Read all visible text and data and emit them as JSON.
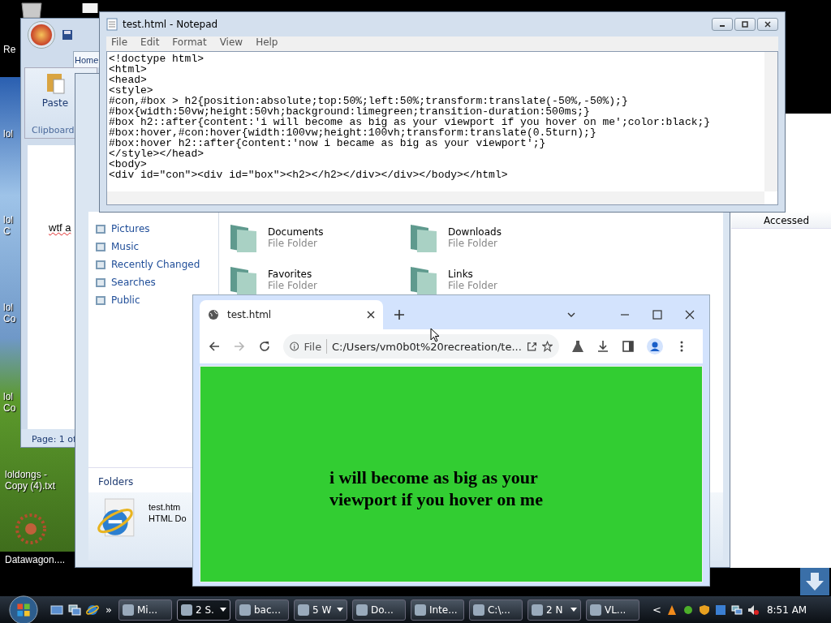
{
  "desktop": {
    "icons": [
      {
        "label": "Re"
      },
      {
        "label": "lol"
      },
      {
        "label": "lol C"
      },
      {
        "label": "lol Co"
      },
      {
        "label": "lol Co"
      },
      {
        "label": "loldongs - Copy (4).txt"
      },
      {
        "label": "Datawagon...."
      }
    ]
  },
  "wordpad": {
    "tabs": [
      {
        "label": "Home",
        "selected": true
      }
    ],
    "paste": "Paste",
    "group": "Clipboard",
    "text": "wtf a",
    "status": "Page: 1 of"
  },
  "explorer": {
    "nav_items": [
      {
        "label": "Pictures"
      },
      {
        "label": "Music"
      },
      {
        "label": "Recently Changed"
      },
      {
        "label": "Searches"
      },
      {
        "label": "Public"
      }
    ],
    "folders_label": "Folders",
    "items": [
      {
        "name": "Documents",
        "type": "File Folder"
      },
      {
        "name": "Downloads",
        "type": "File Folder"
      },
      {
        "name": "Favorites",
        "type": "File Folder"
      },
      {
        "name": "Links",
        "type": "File Folder"
      }
    ],
    "details": {
      "name": "test.htm",
      "type": "HTML Do"
    }
  },
  "side_window": {
    "column_header": "Accessed"
  },
  "notepad": {
    "title": "test.html - Notepad",
    "menu": [
      "File",
      "Edit",
      "Format",
      "View",
      "Help"
    ],
    "lines": [
      "<!doctype html>",
      "<html>",
      "<head>",
      "<style>",
      "#con,#box > h2{position:absolute;top:50%;left:50%;transform:translate(-50%,-50%);}",
      "#box{width:50vw;height:50vh;background:limegreen;transition-duration:500ms;}",
      "#box h2::after{content:'i will become as big as your viewport if you hover on me';color:black;}",
      "#box:hover,#con:hover{width:100vw;height:100vh;transform:translate(0.5turn);}",
      "#box:hover h2::after{content:'now i became as big as your viewport';}",
      "</style></head>",
      "<body>",
      "<div id=\"con\"><div id=\"box\"><h2></h2></div></div></body></html>"
    ]
  },
  "browser": {
    "tabs": [
      {
        "label": "test.html",
        "selected": true
      }
    ],
    "can_go_forward": false,
    "url_scheme": "File",
    "url": "C:/Users/vm0b0t%20recreation/te...",
    "heading": "i will become as big as your viewport if you hover on me"
  },
  "taskbar": {
    "buttons": [
      {
        "label": "Mi...",
        "selected": false,
        "grouped": false
      },
      {
        "label": "2 S.",
        "selected": true,
        "grouped": true
      },
      {
        "label": "bac...",
        "selected": false,
        "grouped": false
      },
      {
        "label": "5 W",
        "selected": false,
        "grouped": true
      },
      {
        "label": "Do...",
        "selected": false,
        "grouped": false
      },
      {
        "label": "Inte...",
        "selected": false,
        "grouped": false
      },
      {
        "label": "C:\\...",
        "selected": false,
        "grouped": false
      },
      {
        "label": "2 N",
        "selected": false,
        "grouped": true
      },
      {
        "label": "VL...",
        "selected": false,
        "grouped": false
      }
    ],
    "overflow": "»",
    "tray_chevron": "<",
    "time": "8:51 AM"
  }
}
